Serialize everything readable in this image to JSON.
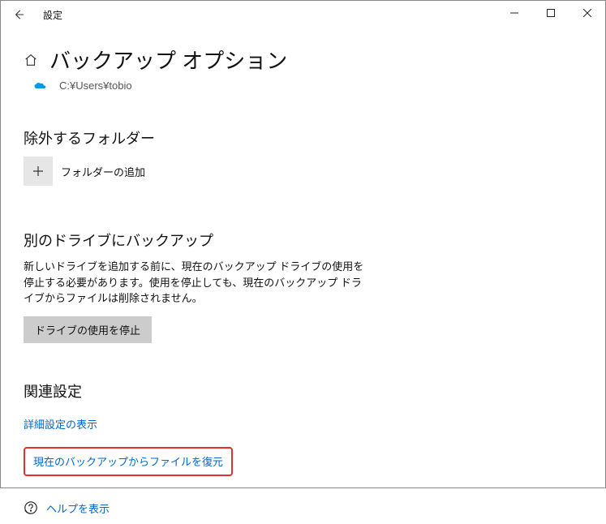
{
  "titlebar": {
    "app_name": "設定"
  },
  "header": {
    "page_title": "バックアップ オプション",
    "onedrive_path": "C:¥Users¥tobio"
  },
  "exclude_section": {
    "heading": "除外するフォルダー",
    "add_label": "フォルダーの追加"
  },
  "other_drive_section": {
    "heading": "別のドライブにバックアップ",
    "description": "新しいドライブを追加する前に、現在のバックアップ ドライブの使用を停止する必要があります。使用を停止しても、現在のバックアップ ドライブからファイルは削除されません。",
    "stop_button": "ドライブの使用を停止"
  },
  "related_section": {
    "heading": "関連設定",
    "detail_link": "詳細設定の表示",
    "restore_link": "現在のバックアップからファイルを復元"
  },
  "help": {
    "label": "ヘルプを表示"
  }
}
